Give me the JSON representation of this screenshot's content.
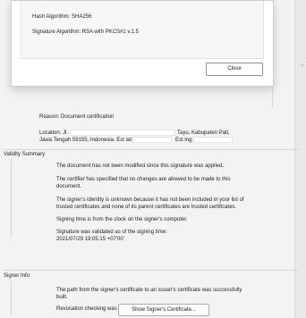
{
  "dialog": {
    "hash_algorithm": "Hash Algorithm: SHA256",
    "signature_algorithm": "Signature Algorithm: RSA with PKCS#1 v.1.5",
    "close_label": "Close"
  },
  "signature_details": {
    "reason": "Reason:  Document certification",
    "location_prefix": "Location:  Jl.",
    "location_suffix": "Tayu, Kabupaten Pati,",
    "location_line2": "Jawa Tengah 59155, Indonesia. Est lat:",
    "est_lng_label": "Est lng:"
  },
  "validity_summary": {
    "title": "Validity Summary",
    "items": [
      "The document has not been modified since this signature was applied.",
      "The certifier has specified that no changes are allowed to be made to this",
      "document.",
      "The signer's identity is unknown because it has not been included in your list of",
      "trusted certificates and none of its parent certificates are trusted certificates.",
      "Signing time is from the clock on the signer's computer.",
      "Signature was validated as of the signing time:",
      "2021/07/29 19:05:15 +07'00'"
    ]
  },
  "signer_info": {
    "title": "Signer Info",
    "path_line1": "The path from the signer's certificate to an issuer's certificate was successfully",
    "path_line2": "built.",
    "revocation": "Revocation checking was not performed.",
    "show_cert_label": "Show Signer's Certificate..."
  },
  "icons": {
    "right_chevron": "chevron-right-icon"
  }
}
